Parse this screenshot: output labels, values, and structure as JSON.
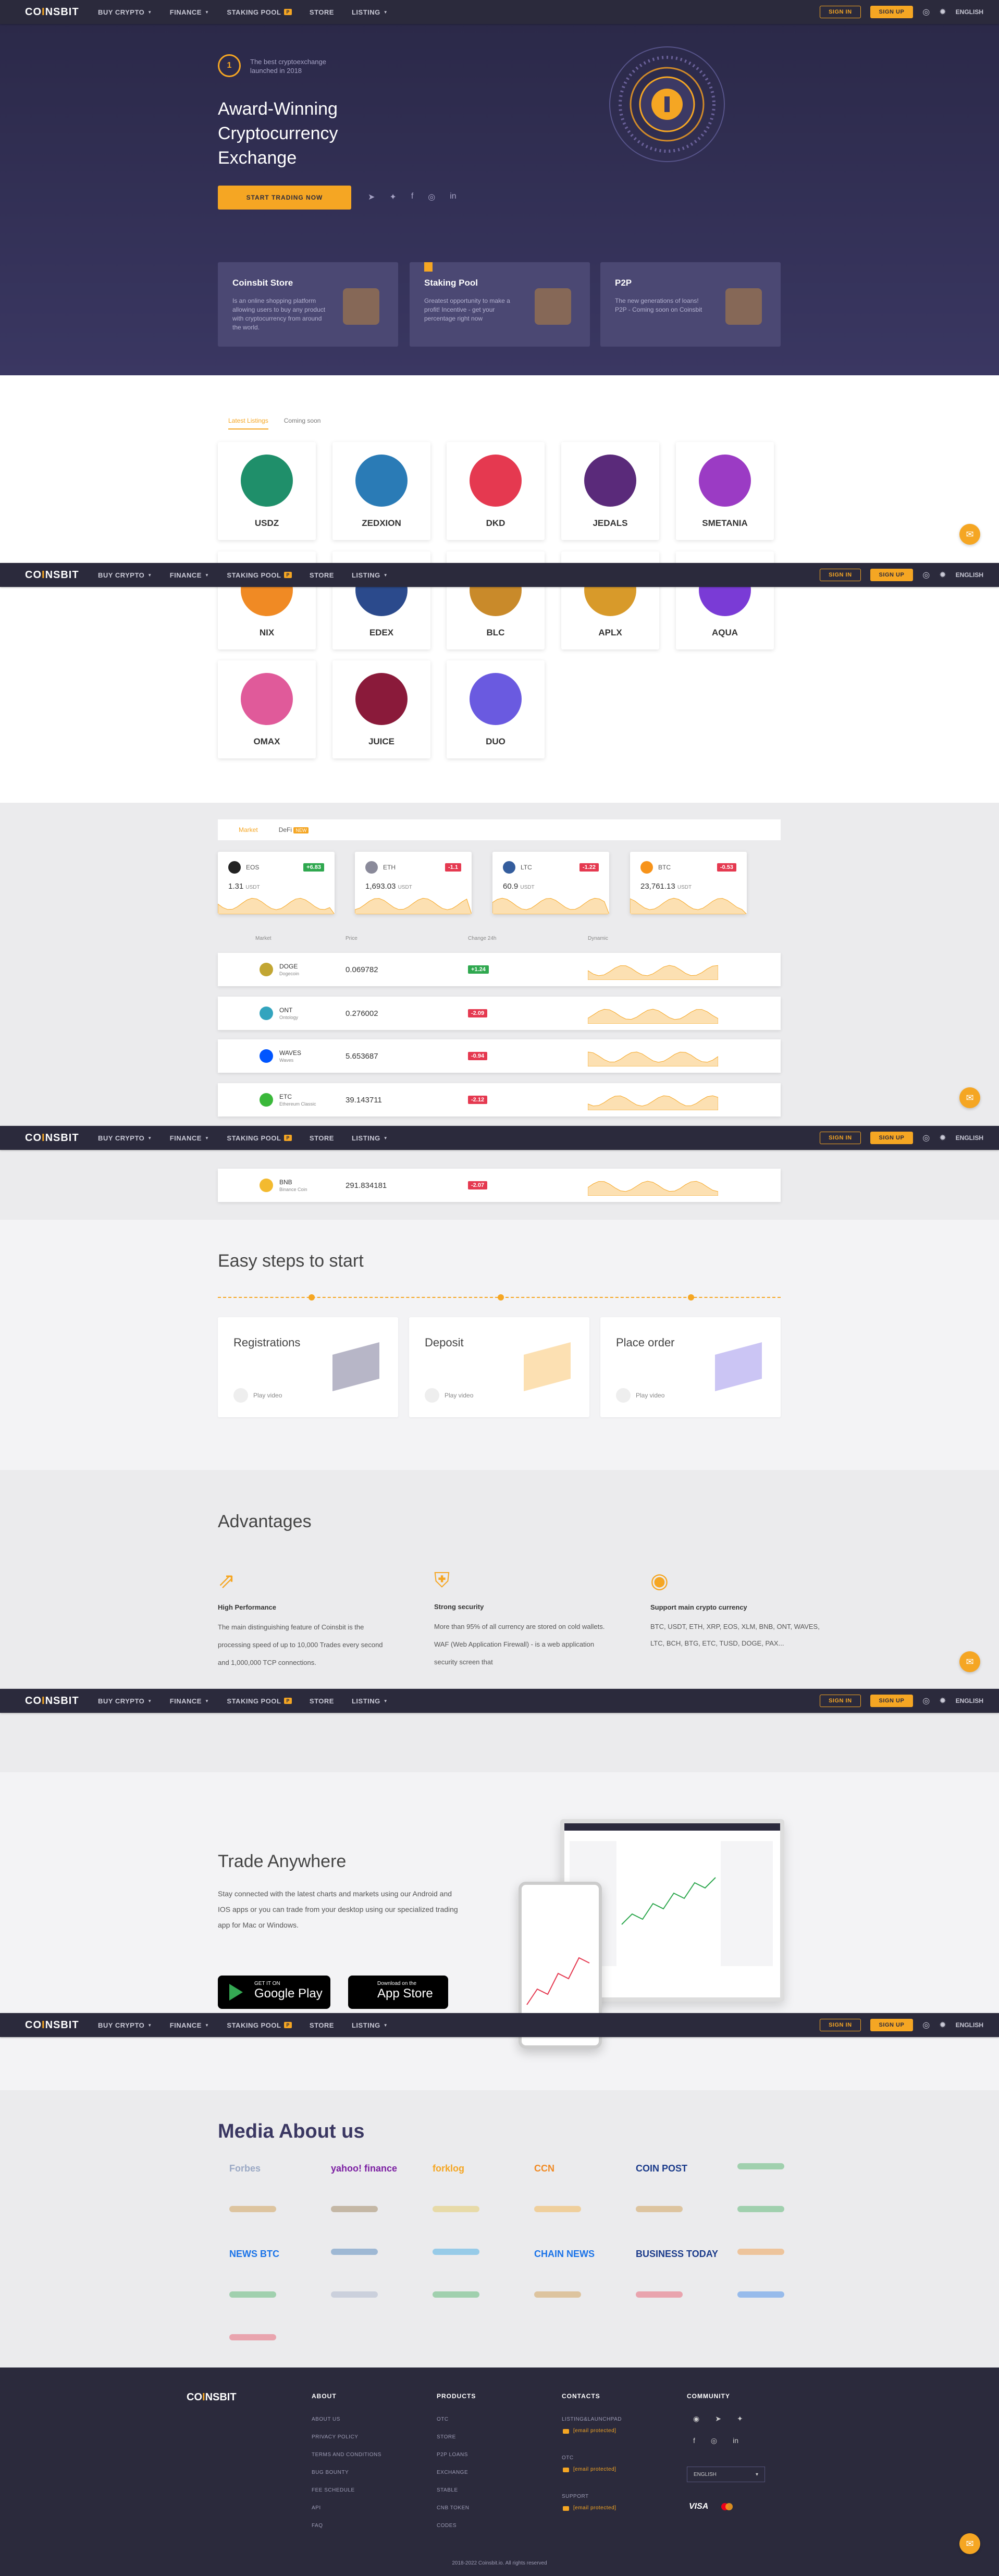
{
  "nav": {
    "logo_prefix": "CO",
    "logo_accent": "I",
    "logo_suffix": "NSBIT",
    "items": [
      "BUY CRYPTO",
      "FINANCE",
      "STAKING POOL",
      "STORE",
      "LISTING"
    ],
    "pool_badge": "P",
    "sign_in": "SIGN IN",
    "sign_up": "SIGN UP",
    "language": "ENGLISH"
  },
  "hero": {
    "badge_line1": "The best cryptoexchange",
    "badge_line2": "launched in 2018",
    "title_line1": "Award-Winning",
    "title_line2": "Cryptocurrency",
    "title_line3": "Exchange",
    "cta": "START TRADING NOW",
    "cards": [
      {
        "title": "Coinsbit Store",
        "text": "Is an online shopping platform allowing users to buy any product with cryptocurrency from around the world."
      },
      {
        "title": "Staking Pool",
        "text": "Greatest opportunity to make a profit! Incentive - get your percentage right now"
      },
      {
        "title": "P2P",
        "text": "The new generations of loans! P2P - Coming soon on Coinsbit"
      }
    ]
  },
  "listings": {
    "tabs": [
      "Latest Listings",
      "Coming soon"
    ],
    "items": [
      {
        "name": "USDZ",
        "color": "#1f8f6a"
      },
      {
        "name": "ZEDXION",
        "color": "#2a7bb6"
      },
      {
        "name": "DKD",
        "color": "#e53950"
      },
      {
        "name": "JEDALS",
        "color": "#5a2a7a"
      },
      {
        "name": "SMETANIA",
        "color": "#9b3bc4"
      },
      {
        "name": "NIX",
        "color": "#f08a24"
      },
      {
        "name": "EDEX",
        "color": "#2b4a8c"
      },
      {
        "name": "BLC",
        "color": "#c98a2a"
      },
      {
        "name": "APLX",
        "color": "#d89a2a"
      },
      {
        "name": "AQUA",
        "color": "#7a3bd6"
      },
      {
        "name": "OMAX",
        "color": "#e05a9a"
      },
      {
        "name": "JUICE",
        "color": "#8a1a3a"
      },
      {
        "name": "DUO",
        "color": "#6a5ae0"
      }
    ]
  },
  "markets": {
    "tabs": [
      "Market",
      "DeFi"
    ],
    "defi_badge": "NEW",
    "top": [
      {
        "symbol": "EOS",
        "change": "+6.83",
        "price": "1.31",
        "quote": "USDT",
        "up": true,
        "color": "#222"
      },
      {
        "symbol": "ETH",
        "change": "-1.1",
        "price": "1,693.03",
        "quote": "USDT",
        "up": false,
        "color": "#8a8a9a"
      },
      {
        "symbol": "LTC",
        "change": "-1.22",
        "price": "60.9",
        "quote": "USDT",
        "up": false,
        "color": "#345d9d"
      },
      {
        "symbol": "BTC",
        "change": "-0.53",
        "price": "23,761.13",
        "quote": "USDT",
        "up": false,
        "color": "#f7931a"
      }
    ],
    "columns": [
      "Market",
      "Price",
      "Change 24h",
      "Dynamic"
    ],
    "rows": [
      {
        "symbol": "DOGE",
        "name": "Dogecoin",
        "price": "0.069782",
        "change": "+1.24",
        "up": true,
        "color": "#c2a633"
      },
      {
        "symbol": "ONT",
        "name": "Ontology",
        "price": "0.276002",
        "change": "-2.09",
        "up": false,
        "color": "#32a4be"
      },
      {
        "symbol": "WAVES",
        "name": "Waves",
        "price": "5.653687",
        "change": "-0.94",
        "up": false,
        "color": "#0055ff"
      },
      {
        "symbol": "ETC",
        "name": "Ethereum Classic",
        "price": "39.143711",
        "change": "-2.12",
        "up": false,
        "color": "#3ab83a"
      },
      {
        "symbol": "BNB",
        "name": "Binance Coin",
        "price": "291.834181",
        "change": "-2.07",
        "up": false,
        "color": "#f3ba2f"
      }
    ]
  },
  "steps": {
    "title": "Easy steps to start",
    "items": [
      {
        "title": "Registrations",
        "video": "Play video"
      },
      {
        "title": "Deposit",
        "video": "Play video"
      },
      {
        "title": "Place order",
        "video": "Play video"
      }
    ]
  },
  "advantages": {
    "title": "Advantages",
    "items": [
      {
        "title": "High Performance",
        "text": "The main distinguishing feature of Coinsbit is the processing speed of up to 10,000 Trades every second and 1,000,000 TCP connections."
      },
      {
        "title": "Strong security",
        "text": "More than 95% of all currency are stored on cold wallets. WAF (Web Application Firewall) - is a web application security screen that"
      },
      {
        "title": "Support main crypto currency",
        "text": "BTC, USDT, ETH, XRP, EOS, XLM, BNB, ONT, WAVES, LTC, BCH, BTG, ETC, TUSD, DOGE, PAX..."
      }
    ]
  },
  "trade": {
    "title": "Trade Anywhere",
    "text": "Stay connected with the latest charts and markets using our Android and IOS apps or you can trade from your desktop using our specialized trading app for Mac or Windows.",
    "gp_small": "GET IT ON",
    "gp_big": "Google Play",
    "as_small": "Download on the",
    "as_big": "App Store"
  },
  "media": {
    "title": "Media About us",
    "logos": [
      "Forbes",
      "yahoo! finance",
      "forklog",
      "CCN",
      "COIN POST",
      "",
      "",
      "",
      "",
      "",
      "",
      "",
      "NEWS BTC",
      "",
      "",
      "CHAIN NEWS",
      "BUSINESS TODAY",
      "",
      "",
      "",
      "",
      "",
      "",
      "",
      ""
    ]
  },
  "footer": {
    "about_h": "ABOUT",
    "about": [
      "ABOUT US",
      "PRIVACY POLICY",
      "TERMS AND CONDITIONS",
      "BUG BOUNTY",
      "FEE SCHEDULE",
      "API",
      "FAQ"
    ],
    "products_h": "PRODUCTS",
    "products": [
      "OTC",
      "STORE",
      "P2P LOANS",
      "EXCHANGE",
      "STABLE",
      "CNB TOKEN",
      "CODES"
    ],
    "contacts_h": "CONTACTS",
    "contacts": [
      {
        "label": "LISTING&LAUNCHPAD",
        "email": "[email protected]"
      },
      {
        "label": "OTC",
        "email": "[email protected]"
      },
      {
        "label": "SUPPORT",
        "email": "[email protected]"
      }
    ],
    "community_h": "COMMUNITY",
    "language": "ENGLISH",
    "visa": "VISA",
    "copyright": "2018-2022 Coinsbit.io. All rights reserved"
  }
}
